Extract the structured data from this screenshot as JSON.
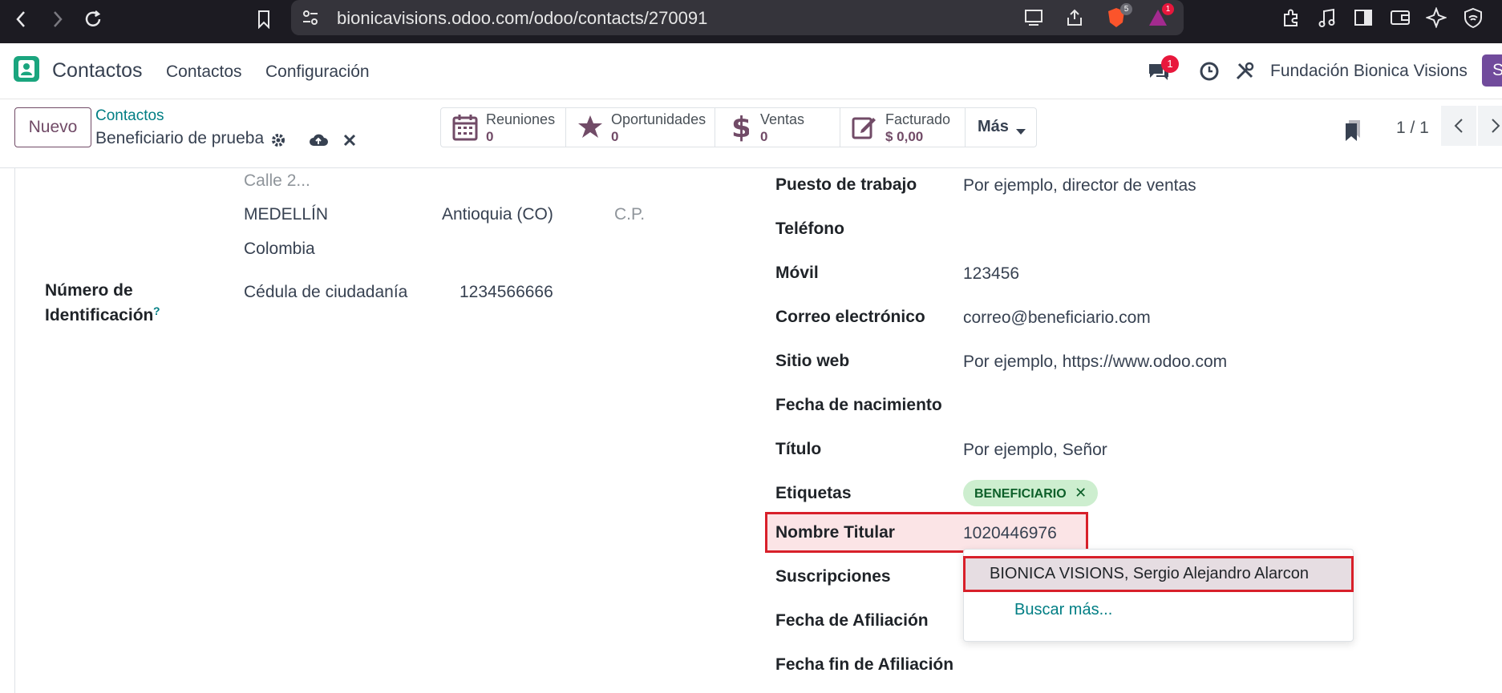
{
  "browser": {
    "url": "bionicavisions.odoo.com/odoo/contacts/270091",
    "brave_badge": "5",
    "alert_badge": "1"
  },
  "navbar": {
    "app_name": "Contactos",
    "menu": [
      "Contactos",
      "Configuración"
    ],
    "chat_count": "1",
    "company": "Fundación Bionica Visions",
    "user_initial": "S"
  },
  "control": {
    "new_button": "Nuevo",
    "breadcrumb_parent": "Contactos",
    "breadcrumb_current": "Beneficiario de prueba",
    "stats": [
      {
        "label": "Reuniones",
        "value": "0",
        "icon": "calendar-icon"
      },
      {
        "label": "Oportunidades",
        "value": "0",
        "icon": "star-icon"
      },
      {
        "label": "Ventas",
        "value": "0",
        "icon": "dollar-icon"
      },
      {
        "label": "Facturado",
        "value": "$ 0,00",
        "icon": "edit-icon"
      }
    ],
    "more_button": "Más",
    "pager": "1 / 1"
  },
  "form": {
    "address": {
      "street2_placeholder": "Calle 2...",
      "city": "MEDELLÍN",
      "state": "Antioquia (CO)",
      "zip_placeholder": "C.P.",
      "country": "Colombia"
    },
    "id_label_line1": "Número de",
    "id_label_line2": "Identificación",
    "id_help": "?",
    "id_type": "Cédula de ciudadanía",
    "id_number": "1234566666",
    "fields": {
      "job_label": "Puesto de trabajo",
      "job_placeholder": "Por ejemplo, director de ventas",
      "phone_label": "Teléfono",
      "mobile_label": "Móvil",
      "mobile_value": "123456",
      "email_label": "Correo electrónico",
      "email_value": "correo@beneficiario.com",
      "website_label": "Sitio web",
      "website_placeholder": "Por ejemplo, https://www.odoo.com",
      "birth_label": "Fecha de nacimiento",
      "title_label": "Título",
      "title_placeholder": "Por ejemplo, Señor",
      "tags_label": "Etiquetas",
      "tag": "BENEFICIARIO",
      "holder_label": "Nombre Titular",
      "holder_value": "1020446976",
      "subs_label": "Suscripciones",
      "affil_label": "Fecha de Afiliación",
      "affil_end_label": "Fecha fin de Afiliación"
    },
    "dropdown": {
      "option": "BIONICA VISIONS, Sergio Alejandro Alarcon",
      "search_more": "Buscar más..."
    }
  },
  "colors": {
    "brand": "#714b67",
    "link": "#017e84",
    "highlight": "#d8202a",
    "tag_bg": "#cdeecf"
  }
}
